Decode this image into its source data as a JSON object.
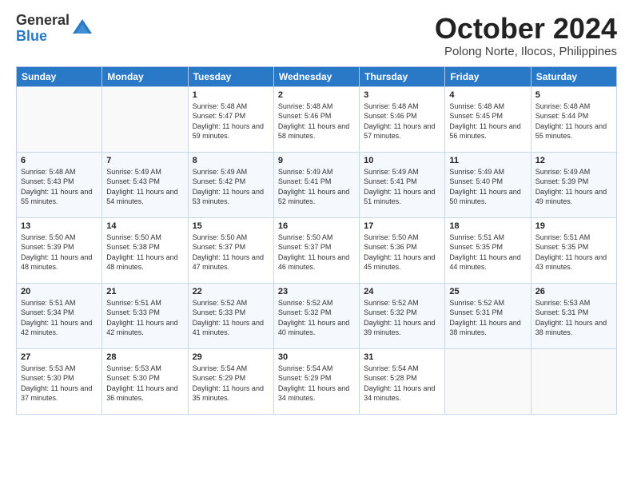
{
  "logo": {
    "general": "General",
    "blue": "Blue"
  },
  "title": "October 2024",
  "subtitle": "Polong Norte, Ilocos, Philippines",
  "days_header": [
    "Sunday",
    "Monday",
    "Tuesday",
    "Wednesday",
    "Thursday",
    "Friday",
    "Saturday"
  ],
  "weeks": [
    [
      {
        "day": "",
        "sunrise": "",
        "sunset": "",
        "daylight": ""
      },
      {
        "day": "",
        "sunrise": "",
        "sunset": "",
        "daylight": ""
      },
      {
        "day": "1",
        "sunrise": "Sunrise: 5:48 AM",
        "sunset": "Sunset: 5:47 PM",
        "daylight": "Daylight: 11 hours and 59 minutes."
      },
      {
        "day": "2",
        "sunrise": "Sunrise: 5:48 AM",
        "sunset": "Sunset: 5:46 PM",
        "daylight": "Daylight: 11 hours and 58 minutes."
      },
      {
        "day": "3",
        "sunrise": "Sunrise: 5:48 AM",
        "sunset": "Sunset: 5:46 PM",
        "daylight": "Daylight: 11 hours and 57 minutes."
      },
      {
        "day": "4",
        "sunrise": "Sunrise: 5:48 AM",
        "sunset": "Sunset: 5:45 PM",
        "daylight": "Daylight: 11 hours and 56 minutes."
      },
      {
        "day": "5",
        "sunrise": "Sunrise: 5:48 AM",
        "sunset": "Sunset: 5:44 PM",
        "daylight": "Daylight: 11 hours and 55 minutes."
      }
    ],
    [
      {
        "day": "6",
        "sunrise": "Sunrise: 5:48 AM",
        "sunset": "Sunset: 5:43 PM",
        "daylight": "Daylight: 11 hours and 55 minutes."
      },
      {
        "day": "7",
        "sunrise": "Sunrise: 5:49 AM",
        "sunset": "Sunset: 5:43 PM",
        "daylight": "Daylight: 11 hours and 54 minutes."
      },
      {
        "day": "8",
        "sunrise": "Sunrise: 5:49 AM",
        "sunset": "Sunset: 5:42 PM",
        "daylight": "Daylight: 11 hours and 53 minutes."
      },
      {
        "day": "9",
        "sunrise": "Sunrise: 5:49 AM",
        "sunset": "Sunset: 5:41 PM",
        "daylight": "Daylight: 11 hours and 52 minutes."
      },
      {
        "day": "10",
        "sunrise": "Sunrise: 5:49 AM",
        "sunset": "Sunset: 5:41 PM",
        "daylight": "Daylight: 11 hours and 51 minutes."
      },
      {
        "day": "11",
        "sunrise": "Sunrise: 5:49 AM",
        "sunset": "Sunset: 5:40 PM",
        "daylight": "Daylight: 11 hours and 50 minutes."
      },
      {
        "day": "12",
        "sunrise": "Sunrise: 5:49 AM",
        "sunset": "Sunset: 5:39 PM",
        "daylight": "Daylight: 11 hours and 49 minutes."
      }
    ],
    [
      {
        "day": "13",
        "sunrise": "Sunrise: 5:50 AM",
        "sunset": "Sunset: 5:39 PM",
        "daylight": "Daylight: 11 hours and 48 minutes."
      },
      {
        "day": "14",
        "sunrise": "Sunrise: 5:50 AM",
        "sunset": "Sunset: 5:38 PM",
        "daylight": "Daylight: 11 hours and 48 minutes."
      },
      {
        "day": "15",
        "sunrise": "Sunrise: 5:50 AM",
        "sunset": "Sunset: 5:37 PM",
        "daylight": "Daylight: 11 hours and 47 minutes."
      },
      {
        "day": "16",
        "sunrise": "Sunrise: 5:50 AM",
        "sunset": "Sunset: 5:37 PM",
        "daylight": "Daylight: 11 hours and 46 minutes."
      },
      {
        "day": "17",
        "sunrise": "Sunrise: 5:50 AM",
        "sunset": "Sunset: 5:36 PM",
        "daylight": "Daylight: 11 hours and 45 minutes."
      },
      {
        "day": "18",
        "sunrise": "Sunrise: 5:51 AM",
        "sunset": "Sunset: 5:35 PM",
        "daylight": "Daylight: 11 hours and 44 minutes."
      },
      {
        "day": "19",
        "sunrise": "Sunrise: 5:51 AM",
        "sunset": "Sunset: 5:35 PM",
        "daylight": "Daylight: 11 hours and 43 minutes."
      }
    ],
    [
      {
        "day": "20",
        "sunrise": "Sunrise: 5:51 AM",
        "sunset": "Sunset: 5:34 PM",
        "daylight": "Daylight: 11 hours and 42 minutes."
      },
      {
        "day": "21",
        "sunrise": "Sunrise: 5:51 AM",
        "sunset": "Sunset: 5:33 PM",
        "daylight": "Daylight: 11 hours and 42 minutes."
      },
      {
        "day": "22",
        "sunrise": "Sunrise: 5:52 AM",
        "sunset": "Sunset: 5:33 PM",
        "daylight": "Daylight: 11 hours and 41 minutes."
      },
      {
        "day": "23",
        "sunrise": "Sunrise: 5:52 AM",
        "sunset": "Sunset: 5:32 PM",
        "daylight": "Daylight: 11 hours and 40 minutes."
      },
      {
        "day": "24",
        "sunrise": "Sunrise: 5:52 AM",
        "sunset": "Sunset: 5:32 PM",
        "daylight": "Daylight: 11 hours and 39 minutes."
      },
      {
        "day": "25",
        "sunrise": "Sunrise: 5:52 AM",
        "sunset": "Sunset: 5:31 PM",
        "daylight": "Daylight: 11 hours and 38 minutes."
      },
      {
        "day": "26",
        "sunrise": "Sunrise: 5:53 AM",
        "sunset": "Sunset: 5:31 PM",
        "daylight": "Daylight: 11 hours and 38 minutes."
      }
    ],
    [
      {
        "day": "27",
        "sunrise": "Sunrise: 5:53 AM",
        "sunset": "Sunset: 5:30 PM",
        "daylight": "Daylight: 11 hours and 37 minutes."
      },
      {
        "day": "28",
        "sunrise": "Sunrise: 5:53 AM",
        "sunset": "Sunset: 5:30 PM",
        "daylight": "Daylight: 11 hours and 36 minutes."
      },
      {
        "day": "29",
        "sunrise": "Sunrise: 5:54 AM",
        "sunset": "Sunset: 5:29 PM",
        "daylight": "Daylight: 11 hours and 35 minutes."
      },
      {
        "day": "30",
        "sunrise": "Sunrise: 5:54 AM",
        "sunset": "Sunset: 5:29 PM",
        "daylight": "Daylight: 11 hours and 34 minutes."
      },
      {
        "day": "31",
        "sunrise": "Sunrise: 5:54 AM",
        "sunset": "Sunset: 5:28 PM",
        "daylight": "Daylight: 11 hours and 34 minutes."
      },
      {
        "day": "",
        "sunrise": "",
        "sunset": "",
        "daylight": ""
      },
      {
        "day": "",
        "sunrise": "",
        "sunset": "",
        "daylight": ""
      }
    ]
  ]
}
